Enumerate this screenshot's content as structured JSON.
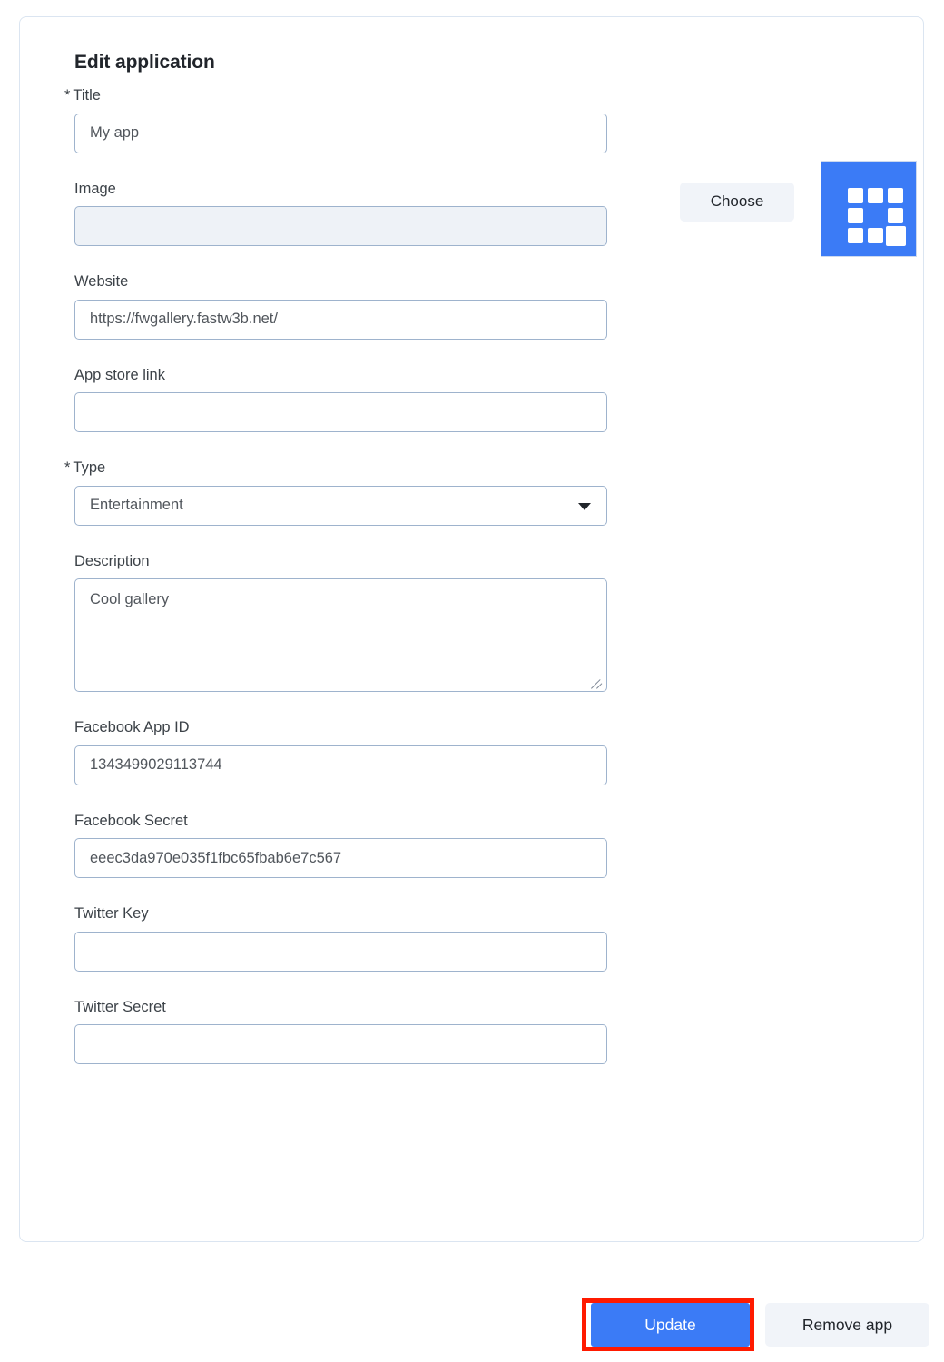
{
  "card": {
    "title": "Edit application"
  },
  "form": {
    "title_field": {
      "label": "Title",
      "required_mark": "*",
      "value": "My app"
    },
    "image_field": {
      "label": "Image",
      "value": "",
      "choose_label": "Choose",
      "icon_name": "app-grid-icon",
      "icon_color": "#3b7bf6"
    },
    "website_field": {
      "label": "Website",
      "value": "https://fwgallery.fastw3b.net/"
    },
    "app_store_field": {
      "label": "App store link",
      "value": ""
    },
    "type_field": {
      "label": "Type",
      "required_mark": "*",
      "value": "Entertainment",
      "options": [
        "Entertainment"
      ]
    },
    "description_field": {
      "label": "Description",
      "value": "Cool gallery"
    },
    "facebook_app_id_field": {
      "label": "Facebook App ID",
      "value": "1343499029113744"
    },
    "facebook_secret_field": {
      "label": "Facebook Secret",
      "value": "eeec3da970e035f1fbc65fbab6e7c567"
    },
    "twitter_key_field": {
      "label": "Twitter Key",
      "value": ""
    },
    "twitter_secret_field": {
      "label": "Twitter Secret",
      "value": ""
    }
  },
  "actions": {
    "update_label": "Update",
    "remove_label": "Remove app",
    "update_color": "#3b7bf6",
    "highlight_color": "#ff1a00"
  }
}
